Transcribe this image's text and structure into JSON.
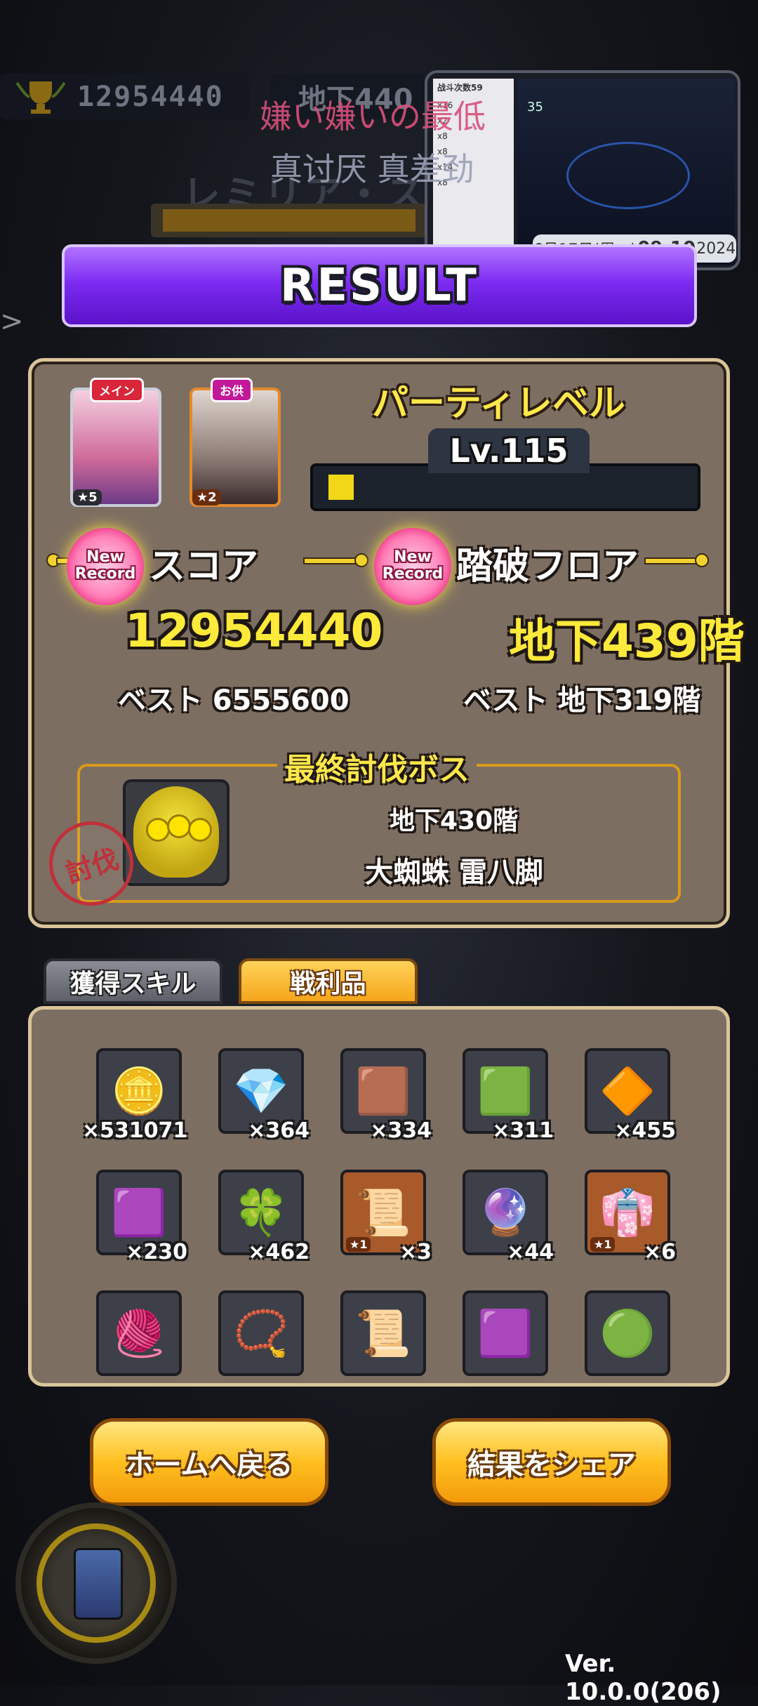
{
  "background": {
    "score_bar": "12954440",
    "floor_bar": "地下440",
    "character_name_bg": "レミリア・スカー"
  },
  "overlay": {
    "line1": "嫌い嫌いの最低",
    "line2": "真讨厌 真差劲"
  },
  "pip": {
    "left_title": "战斗次数59",
    "left_items": [
      "x16",
      "x2",
      "x8",
      "x8",
      "x14",
      "x8"
    ],
    "right_header": "35",
    "clock_date": "6月17日(周一)",
    "clock_time": "09:10",
    "clock_extra": "2024"
  },
  "result": {
    "title": "RESULT"
  },
  "party": {
    "main_tag": "メイン",
    "sub_tag": "お供",
    "main_stars": "5",
    "sub_stars": "2",
    "label": "パーティレベル",
    "level": "Lv.115",
    "level_progress": 0.06
  },
  "score": {
    "new_record": "New Record",
    "label": "スコア",
    "value": "12954440",
    "best": "ベスト 6555600"
  },
  "floor": {
    "new_record": "New Record",
    "label": "踏破フロア",
    "value": "地下439階",
    "best": "ベスト 地下319階"
  },
  "boss": {
    "title": "最終討伐ボス",
    "floor": "地下430階",
    "name": "大蜘蛛 雷八脚",
    "seal": "討伐"
  },
  "tabs": {
    "skills": "獲得スキル",
    "loot": "戦利品"
  },
  "loot": [
    {
      "icon": "gold-coin-icon",
      "glyph": "🪙",
      "qty": "×531071"
    },
    {
      "icon": "diamond-icon",
      "glyph": "💎",
      "qty": "×364"
    },
    {
      "icon": "cloth-roll-icon",
      "glyph": "🟫",
      "qty": "×334"
    },
    {
      "icon": "green-card-icon",
      "glyph": "🟩",
      "qty": "×311"
    },
    {
      "icon": "gem-shards-icon",
      "glyph": "🔶",
      "qty": "×455"
    },
    {
      "icon": "pink-cloth-icon",
      "glyph": "🟪",
      "qty": "×230"
    },
    {
      "icon": "clover-icon",
      "glyph": "🍀",
      "qty": "×462"
    },
    {
      "icon": "talisman-icon",
      "glyph": "📜",
      "qty": "×3",
      "star": "1"
    },
    {
      "icon": "pink-crystal-icon",
      "glyph": "🔮",
      "qty": "×44"
    },
    {
      "icon": "kimono-icon",
      "glyph": "👘",
      "qty": "×6",
      "star": "1"
    },
    {
      "icon": "rope-icon",
      "glyph": "🧶",
      "qty": ""
    },
    {
      "icon": "pendant-icon",
      "glyph": "📿",
      "qty": ""
    },
    {
      "icon": "blue-talisman-icon",
      "glyph": "📜",
      "qty": ""
    },
    {
      "icon": "purple-cloth-icon",
      "glyph": "🟪",
      "qty": ""
    },
    {
      "icon": "magatama-icon",
      "glyph": "🟢",
      "qty": ""
    }
  ],
  "buttons": {
    "home": "ホームへ戻る",
    "share": "結果をシェア"
  },
  "version": "Ver. 10.0.0(206)"
}
